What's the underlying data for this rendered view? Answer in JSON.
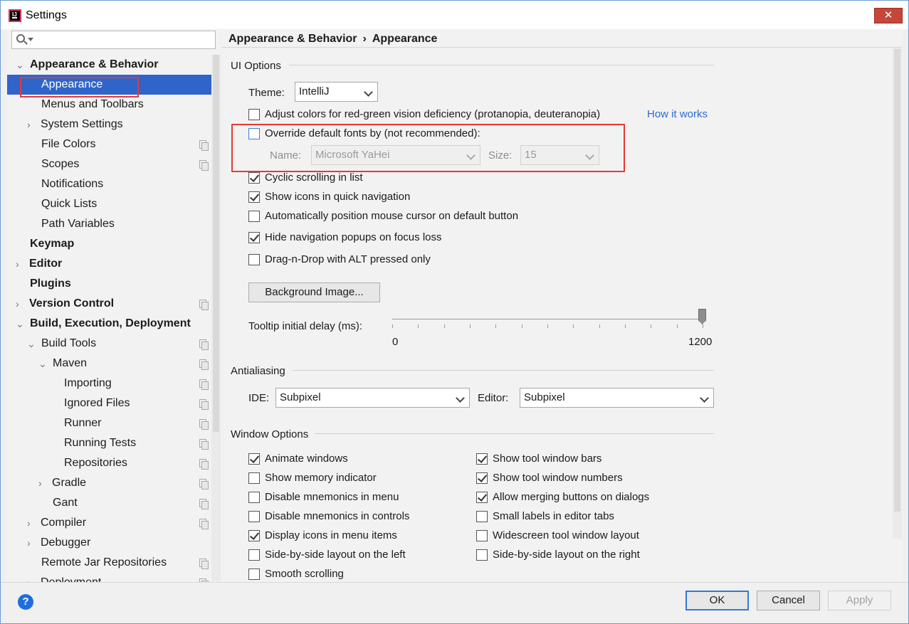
{
  "window": {
    "title": "Settings",
    "close_label": "✕"
  },
  "search": {
    "placeholder": ""
  },
  "sidebar": {
    "items": [
      {
        "label": "Appearance & Behavior",
        "arrow": "⌄"
      },
      {
        "label": "Appearance"
      },
      {
        "label": "Menus and Toolbars"
      },
      {
        "label": "System Settings",
        "arrow": "›"
      },
      {
        "label": "File Colors"
      },
      {
        "label": "Scopes"
      },
      {
        "label": "Notifications"
      },
      {
        "label": "Quick Lists"
      },
      {
        "label": "Path Variables"
      },
      {
        "label": "Keymap"
      },
      {
        "label": "Editor",
        "arrow": "›"
      },
      {
        "label": "Plugins"
      },
      {
        "label": "Version Control",
        "arrow": "›"
      },
      {
        "label": "Build, Execution, Deployment",
        "arrow": "⌄"
      },
      {
        "label": "Build Tools",
        "arrow": "⌄"
      },
      {
        "label": "Maven",
        "arrow": "⌄"
      },
      {
        "label": "Importing"
      },
      {
        "label": "Ignored Files"
      },
      {
        "label": "Runner"
      },
      {
        "label": "Running Tests"
      },
      {
        "label": "Repositories"
      },
      {
        "label": "Gradle",
        "arrow": "›"
      },
      {
        "label": "Gant"
      },
      {
        "label": "Compiler",
        "arrow": "›"
      },
      {
        "label": "Debugger",
        "arrow": "›"
      },
      {
        "label": "Remote Jar Repositories"
      },
      {
        "label": "Deployment",
        "arrow": "›"
      }
    ]
  },
  "breadcrumb": {
    "parent": "Appearance & Behavior",
    "separator": "›",
    "current": "Appearance"
  },
  "ui_options": {
    "title": "UI Options",
    "theme_label": "Theme:",
    "theme_value": "IntelliJ",
    "adjust_colors": "Adjust colors for red-green vision deficiency (protanopia, deuteranopia)",
    "how_it_works": "How it works",
    "override_fonts": "Override default fonts by (not recommended):",
    "name_label": "Name:",
    "name_value": "Microsoft YaHei",
    "size_label": "Size:",
    "size_value": "15",
    "cyclic_scrolling": "Cyclic scrolling in list",
    "show_icons": "Show icons in quick navigation",
    "auto_position": "Automatically position mouse cursor on default button",
    "hide_popups": "Hide navigation popups on focus loss",
    "drag_drop": "Drag-n-Drop with ALT pressed only",
    "background_image": "Background Image...",
    "tooltip_label": "Tooltip initial delay (ms):",
    "tooltip_min": "0",
    "tooltip_max": "1200",
    "tooltip_value_fraction": 1.0
  },
  "antialiasing": {
    "title": "Antialiasing",
    "ide_label": "IDE:",
    "ide_value": "Subpixel",
    "editor_label": "Editor:",
    "editor_value": "Subpixel"
  },
  "window_options": {
    "title": "Window Options",
    "left": [
      {
        "label": "Animate windows",
        "checked": true
      },
      {
        "label": "Show memory indicator",
        "checked": false
      },
      {
        "label": "Disable mnemonics in menu",
        "checked": false
      },
      {
        "label": "Disable mnemonics in controls",
        "checked": false
      },
      {
        "label": "Display icons in menu items",
        "checked": true
      },
      {
        "label": "Side-by-side layout on the left",
        "checked": false
      },
      {
        "label": "Smooth scrolling",
        "checked": false
      }
    ],
    "right": [
      {
        "label": "Show tool window bars",
        "checked": true
      },
      {
        "label": "Show tool window numbers",
        "checked": true
      },
      {
        "label": "Allow merging buttons on dialogs",
        "checked": true
      },
      {
        "label": "Small labels in editor tabs",
        "checked": false
      },
      {
        "label": "Widescreen tool window layout",
        "checked": false
      },
      {
        "label": "Side-by-side layout on the right",
        "checked": false
      }
    ]
  },
  "footer": {
    "help": "?",
    "ok": "OK",
    "cancel": "Cancel",
    "apply": "Apply"
  },
  "colors": {
    "selection": "#2f65ca",
    "highlight_box": "#e53935",
    "link": "#2b6bd6"
  }
}
